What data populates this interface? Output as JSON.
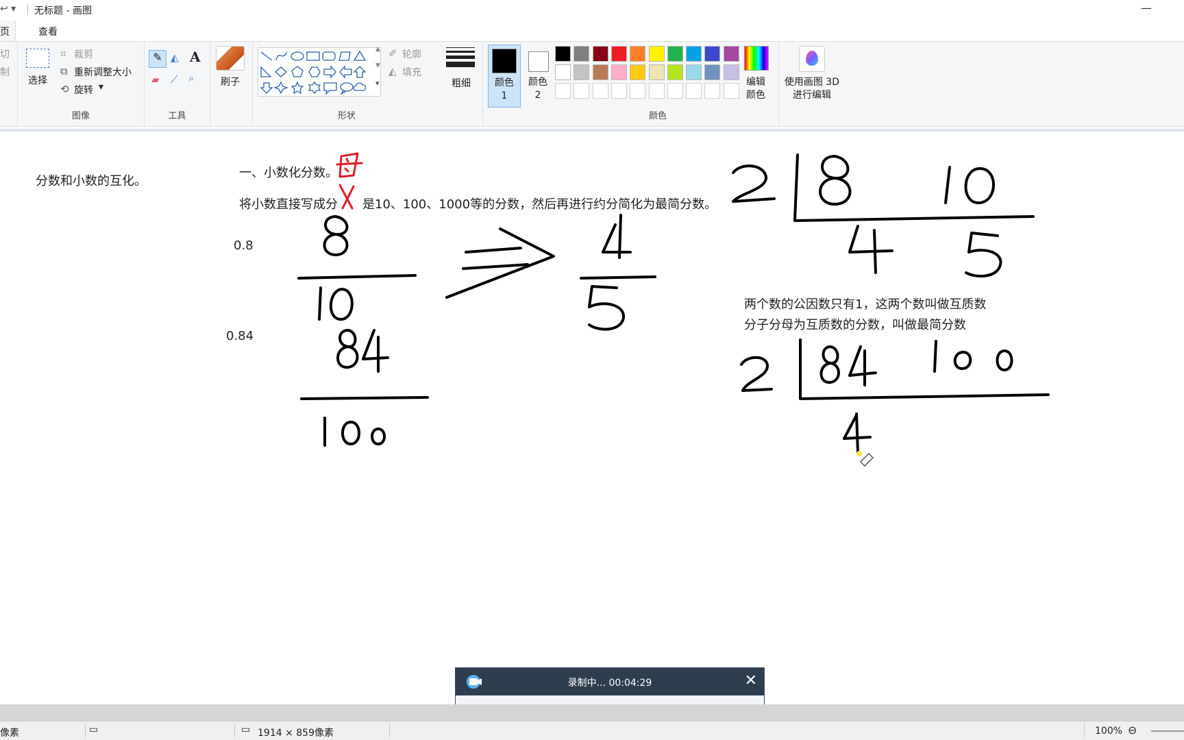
{
  "window": {
    "title": "无标题 - 画图",
    "quick_access": "↩ ▾",
    "minimize": "—"
  },
  "tabs": {
    "home": "主页",
    "view": "查看"
  },
  "ribbon": {
    "clipboard": {
      "cut": "剪切",
      "copy": "复制"
    },
    "image": {
      "label": "图像",
      "select": "选择",
      "crop": "裁剪",
      "resize": "重新调整大小",
      "rotate": "旋转"
    },
    "tools": {
      "label": "工具"
    },
    "brush": {
      "label": "刷子"
    },
    "shapes": {
      "label": "形状",
      "outline": "轮廓",
      "fill": "填充"
    },
    "size": {
      "label": "粗细"
    },
    "color1": {
      "label": "颜色 1",
      "value": "#000000"
    },
    "color2": {
      "label": "颜色 2",
      "value": "#ffffff"
    },
    "colors": {
      "label": "颜色",
      "row1": [
        "#000000",
        "#7f7f7f",
        "#880015",
        "#ed1c24",
        "#ff7f27",
        "#fff200",
        "#22b14c",
        "#00a2e8",
        "#3f48cc",
        "#a349a4"
      ],
      "row2": [
        "#ffffff",
        "#c3c3c3",
        "#b97a57",
        "#ffaec9",
        "#ffc90e",
        "#efe4b0",
        "#b5e61d",
        "#99d9ea",
        "#7092be",
        "#c8bfe7"
      ],
      "row3": [
        "#ffffff",
        "#ffffff",
        "#ffffff",
        "#ffffff",
        "#ffffff",
        "#ffffff",
        "#ffffff",
        "#ffffff",
        "#ffffff",
        "#ffffff"
      ]
    },
    "edit_colors": "编辑颜色",
    "paint3d": "使用画图 3D 进行编辑"
  },
  "canvas": {
    "topic": "分数和小数的互化。",
    "heading": "一、小数化分数。",
    "rule_part1": "将小数直接写成分",
    "rule_part2": "是10、100、1000等的分数，然后再进行约分简化为最简分数。",
    "decimal_1": "0.8",
    "decimal_2": "0.84",
    "definition_1": "两个数的公因数只有1，这两个数叫做互质数",
    "definition_2": "分子分母为互质数的分数，叫做最简分数"
  },
  "recorder": {
    "status": "录制中... 00:04:29"
  },
  "statusbar": {
    "unit": "像素",
    "dimensions": "1914 × 859像素",
    "zoom": "100%"
  }
}
